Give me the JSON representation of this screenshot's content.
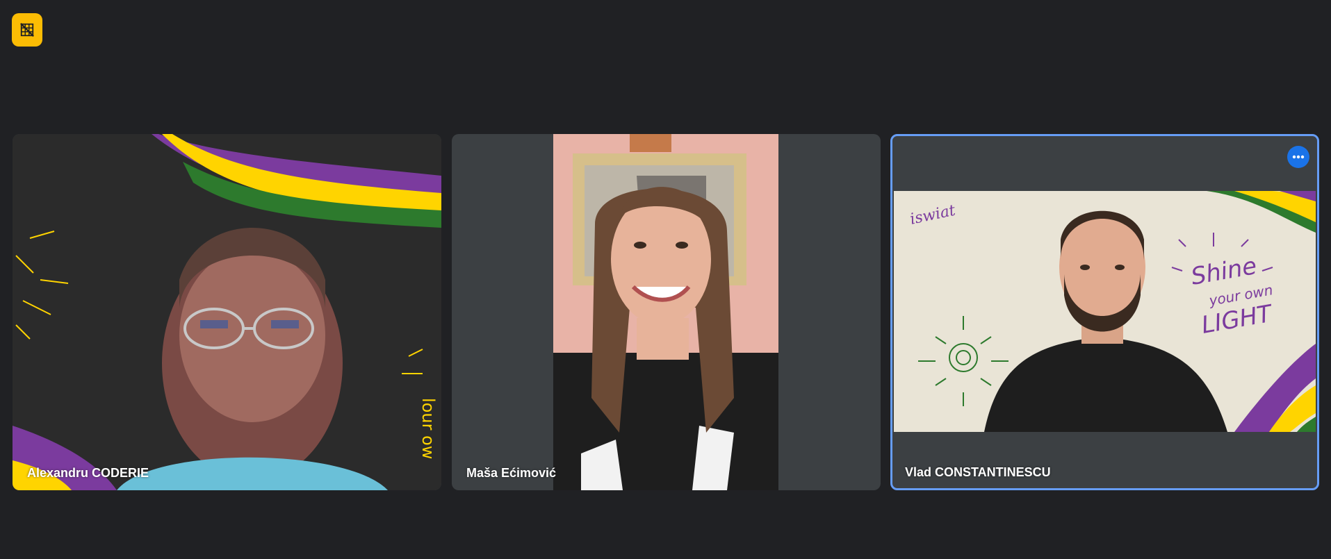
{
  "corner_button": {
    "icon": "grid-off-icon",
    "color": "#fbbc04"
  },
  "participants": [
    {
      "name": "Alexandru CODERIE"
    },
    {
      "name": "Maša Ećimović"
    },
    {
      "name": "Vlad CONSTANTINESCU",
      "pinned": true,
      "more_icon": "more-horiz-icon"
    }
  ],
  "backgrounds": {
    "left": {
      "text": "lour ow"
    },
    "right": {
      "logo": "iswiat",
      "slogan_line1": "Shine",
      "slogan_line2": "your own",
      "slogan_line3": "LIGHT"
    }
  },
  "colors": {
    "page_bg": "#202124",
    "tile_bg": "#3c4043",
    "active_border": "#669df6",
    "purple": "#7b3b9e",
    "yellow": "#ffd400",
    "green": "#2d7a2d"
  }
}
